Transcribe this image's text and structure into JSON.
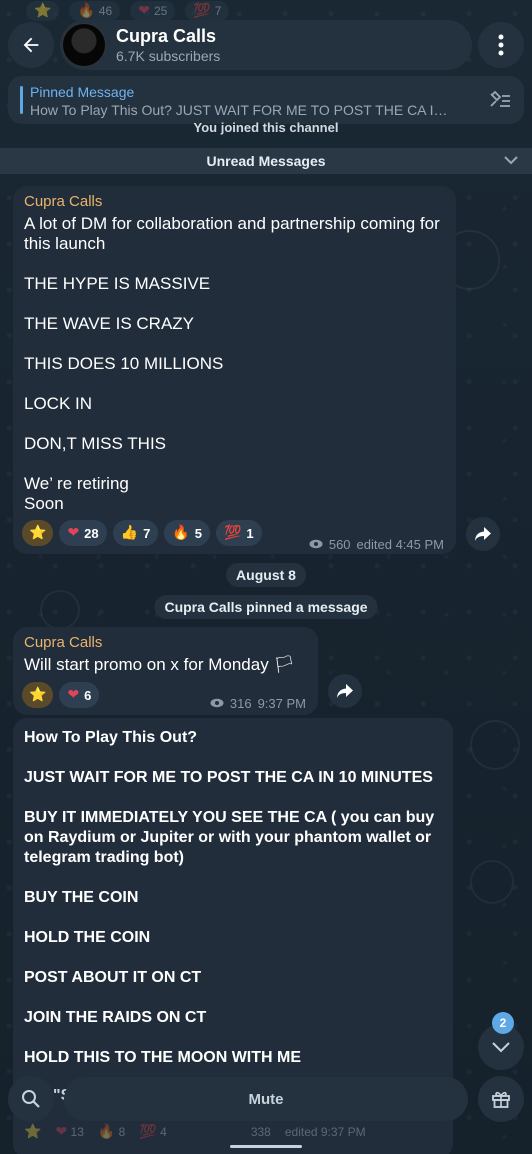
{
  "colors": {
    "background": "#16232e",
    "bubble": "#212d3b",
    "accent": "#5ea8e6",
    "sender": "#e9b46b",
    "meta": "#8c99a6"
  },
  "top_strip": {
    "items": [
      {
        "emoji": "⭐",
        "count": ""
      },
      {
        "emoji": "🔥",
        "count": "46"
      },
      {
        "emoji": "❤",
        "count": "25"
      },
      {
        "emoji": "💯",
        "count": "7"
      }
    ]
  },
  "header": {
    "back_icon": "arrow-left-icon",
    "title": "Cupra Calls",
    "subtitle": "6.7K subscribers",
    "menu_icon": "more-vertical-icon"
  },
  "pinned": {
    "label": "Pinned Message",
    "text": "How To Play This Out?  JUST WAIT FOR ME TO POST THE CA I…"
  },
  "joined_text": "You joined this channel",
  "unread": {
    "label": "Unread Messages"
  },
  "messages": [
    {
      "sender": "Cupra Calls",
      "text": "A lot of DM for collaboration and partnership coming for this launch\n\nTHE HYPE IS MASSIVE\n\nTHE WAVE IS CRAZY\n\nTHIS DOES 10 MILLIONS\n\nLOCK IN\n\nDON,T MISS THIS\n\nWe’ re retiring\nSoon",
      "reactions": [
        {
          "emoji": "⭐",
          "count": ""
        },
        {
          "emoji": "❤",
          "count": "28"
        },
        {
          "emoji": "👍",
          "count": "7"
        },
        {
          "emoji": "🔥",
          "count": "5"
        },
        {
          "emoji": "💯",
          "count": "1"
        }
      ],
      "views": "560",
      "time": "edited 4:45 PM"
    },
    {
      "sender": "Cupra Calls",
      "text": "Will start promo on x for Monday 🏳",
      "reactions": [
        {
          "emoji": "⭐",
          "count": ""
        },
        {
          "emoji": "❤",
          "count": "6"
        }
      ],
      "views": "316",
      "time": "9:37 PM"
    },
    {
      "sender": "",
      "text": "How To Play This Out?\n\nJUST WAIT FOR ME TO POST THE CA IN 10 MINUTES\n\nBUY IT IMMEDIATELY YOU SEE THE CA ( you can buy on Raydium  or Jupiter or with your phantom wallet or telegram trading bot)\n\nBUY THE COIN\n\nHOLD THE COIN\n\nPOST ABOUT IT ON CT\n\nJOIN THE RAIDS ON CT\n\nHOLD THIS TO THE MOON WITH ME",
      "tail": "\"S",
      "bottom_reactions": [
        {
          "emoji": "⭐",
          "count": ""
        },
        {
          "emoji": "❤",
          "count": "13"
        },
        {
          "emoji": "🔥",
          "count": "8"
        },
        {
          "emoji": "💯",
          "count": "4"
        }
      ],
      "views": "338",
      "time": "edited 9:37 PM"
    }
  ],
  "service_messages": {
    "date": "August 8",
    "pinned": "Cupra Calls pinned a message"
  },
  "bottom": {
    "mute_label": "Mute",
    "unread_badge": "2"
  }
}
